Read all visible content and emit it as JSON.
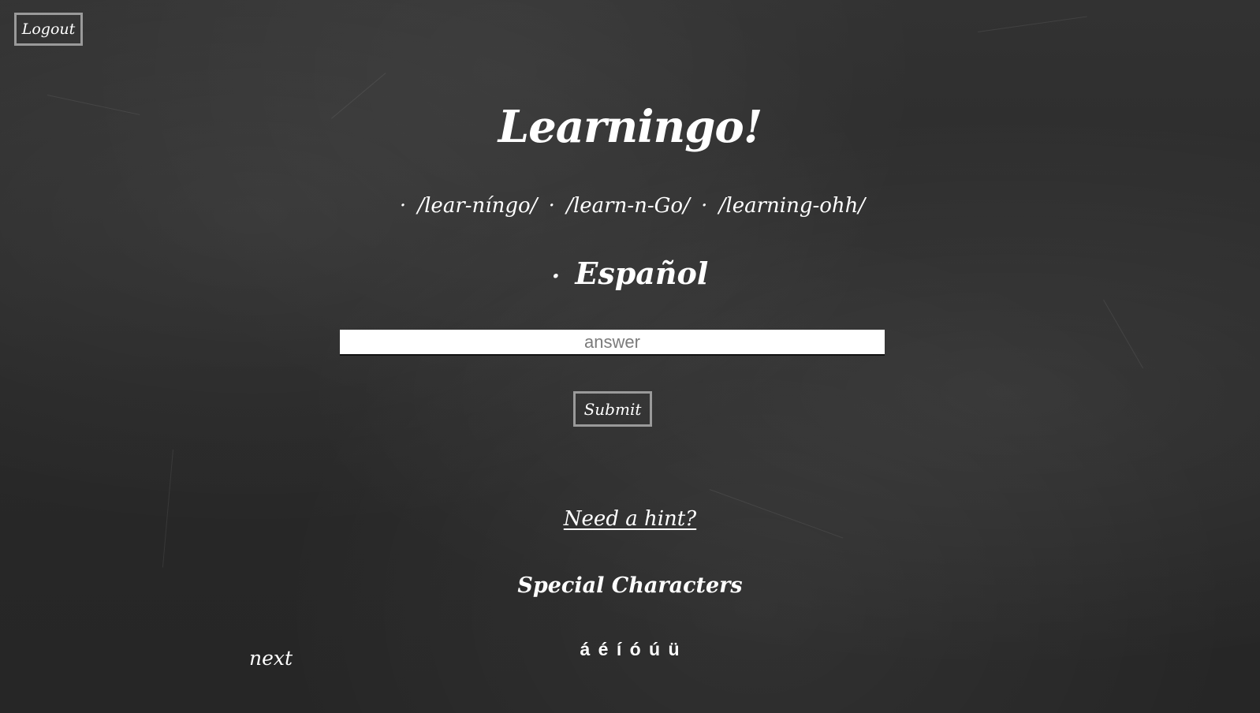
{
  "header": {
    "logout_label": "Logout"
  },
  "main": {
    "title": "Learningo!",
    "pronunciations": [
      "/lear-níngo/",
      "/learn-n-Go/",
      "/learning-ohh/"
    ],
    "separator": "·",
    "language_bullet": "·",
    "language": "Español",
    "answer_placeholder": "answer",
    "answer_value": "",
    "submit_label": "Submit",
    "hint_label": "Need a hint?",
    "special_title": "Special Characters",
    "special_chars": [
      "á",
      "é",
      "í",
      "ó",
      "ú",
      "ü"
    ],
    "next_label": "next"
  },
  "colors": {
    "background": "#2b2b2b",
    "text": "#ffffff",
    "button_border": "#9a9a9a"
  }
}
